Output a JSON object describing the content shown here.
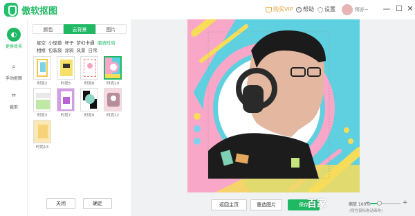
{
  "app": {
    "title": "傲软抠图"
  },
  "titlebar": {
    "vip_label": "购买VIP",
    "help_label": "帮助",
    "settings_label": "设置",
    "username": "阿亦~",
    "min_symbol": "—",
    "max_symbol": "☐",
    "close_symbol": "✕"
  },
  "leftnav": {
    "items": [
      {
        "label": "更换背景",
        "icon": "palette-icon",
        "glyph": "◐",
        "active": true
      },
      {
        "label": "手动抠图",
        "icon": "magnifier-icon",
        "glyph": "⌕",
        "active": false
      },
      {
        "label": "裁剪",
        "icon": "crop-icon",
        "glyph": "⌗",
        "active": false
      }
    ]
  },
  "panel": {
    "tabs": [
      {
        "label": "颜色",
        "active": false
      },
      {
        "label": "云背景",
        "active": true
      },
      {
        "label": "图片",
        "active": false
      }
    ],
    "categories_row1": [
      "星空",
      "小怪兽",
      "杯子",
      "梦幻卡通",
      "潮流时尚"
    ],
    "categories_row2": [
      "相框",
      "包装袋",
      "涂鸦",
      "风景",
      "日常"
    ],
    "active_category": "潮流时尚",
    "thumbnails": [
      {
        "label": "时尚2"
      },
      {
        "label": "时尚5"
      },
      {
        "label": "时尚8"
      },
      {
        "label": "时尚10"
      },
      {
        "label": "时尚3"
      },
      {
        "label": "时尚7"
      },
      {
        "label": "时尚9"
      },
      {
        "label": "时尚12"
      },
      {
        "label": "时尚13"
      }
    ],
    "close_label": "关闭",
    "confirm_label": "确定"
  },
  "bottom": {
    "back_label": "返回主页",
    "reselect_label": "重选图片",
    "save_label": "保存",
    "watermark": "百家",
    "zoom_label": "缩放 100%",
    "zoom_level": 0.3,
    "zoom_minus": "−",
    "zoom_plus": "+",
    "zoom_tip": "(按住鼠标拖动画布)"
  },
  "colors": {
    "accent": "#1fb863",
    "vip": "#e9a33c",
    "artboard_bg": "#5fd0e0",
    "pink": "#f8a7c8",
    "yellow": "#f7dc5a"
  }
}
